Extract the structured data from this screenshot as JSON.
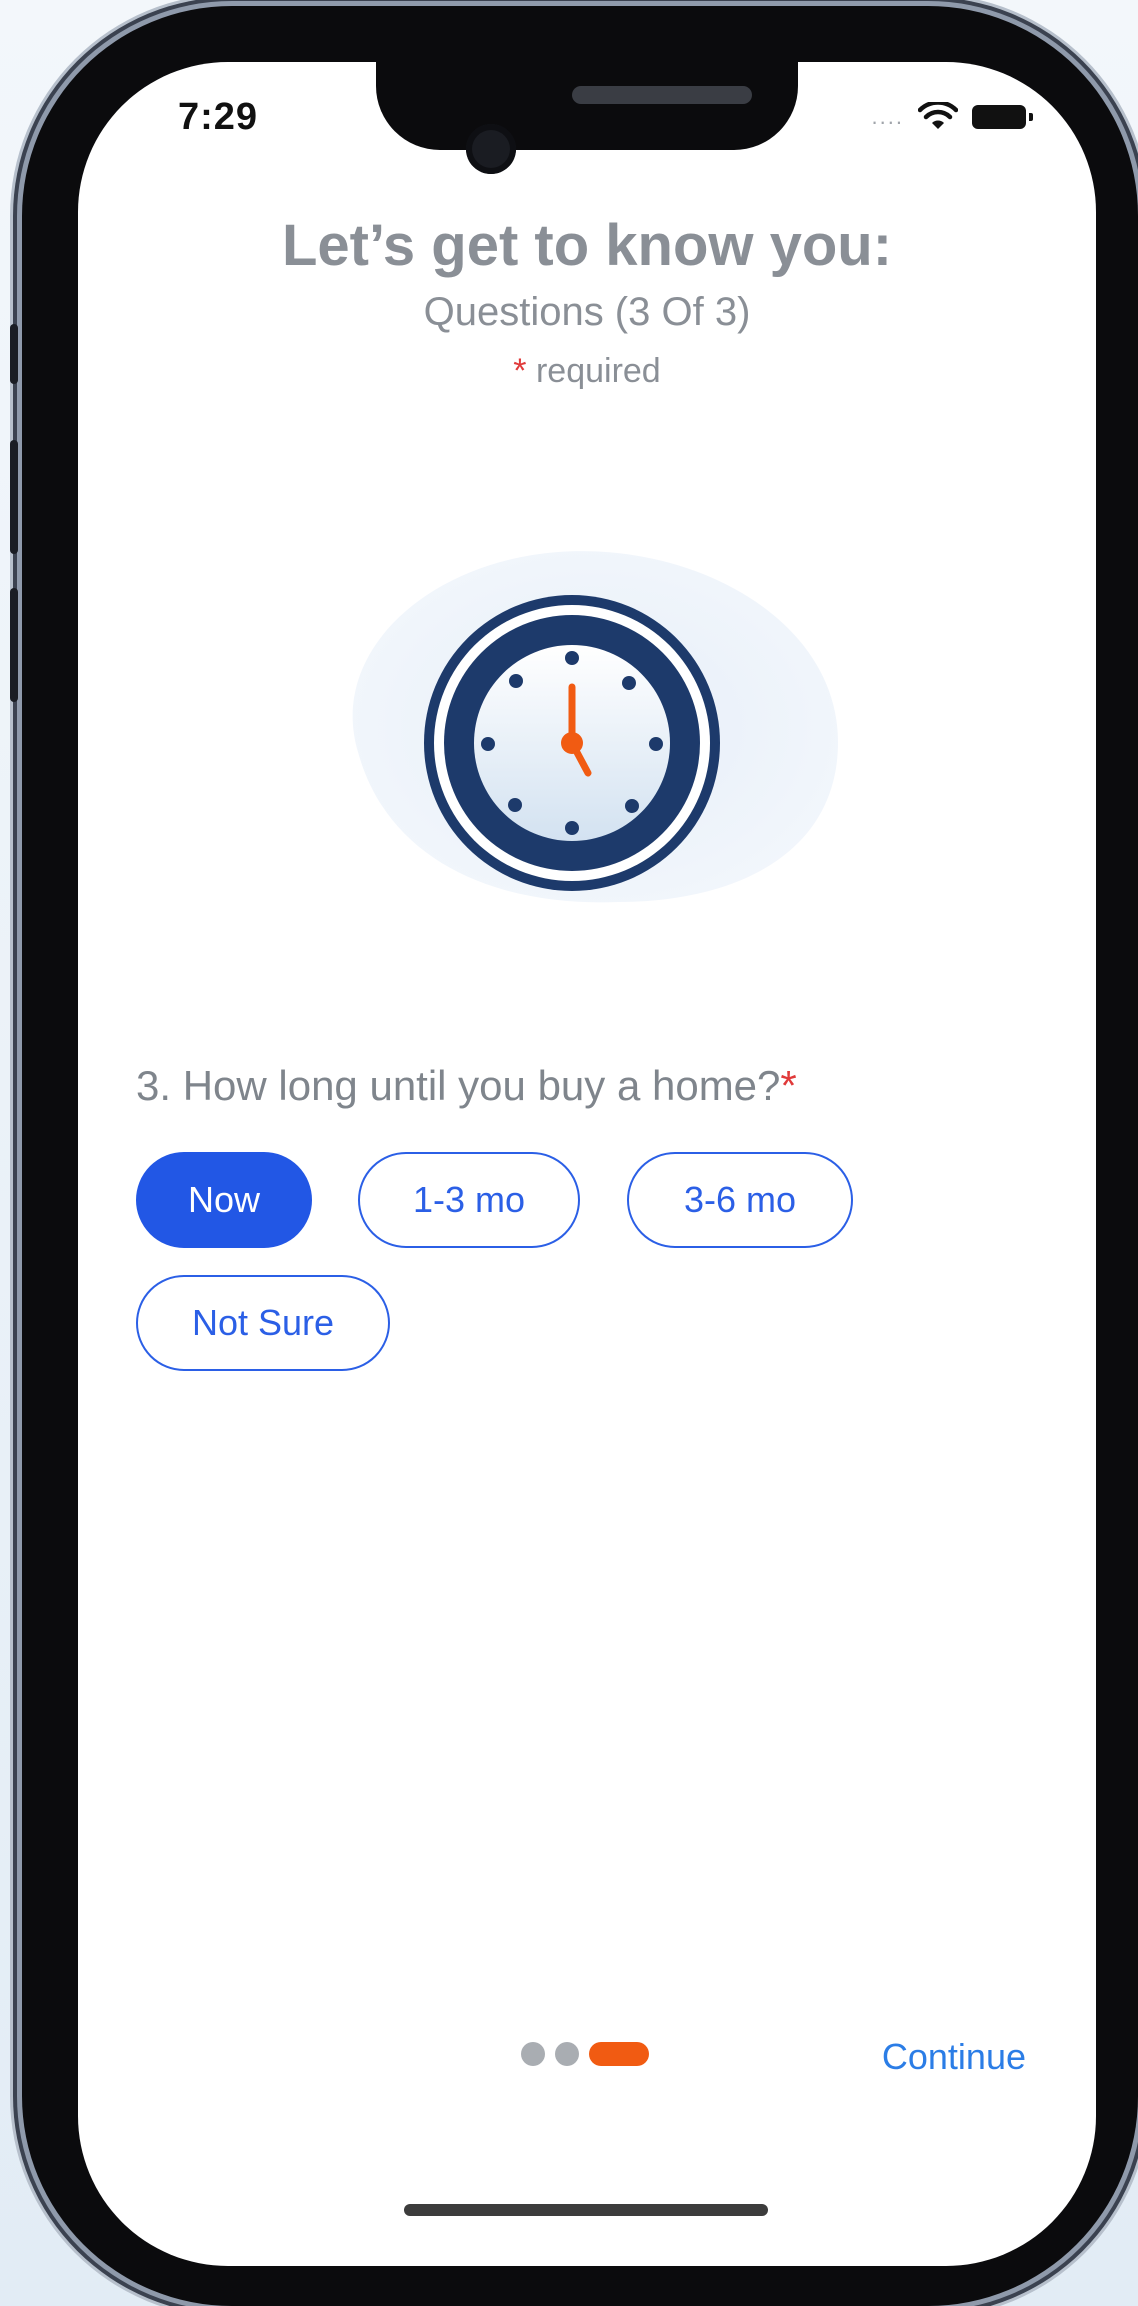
{
  "status_bar": {
    "time": "7:29",
    "signal": "....",
    "wifi_icon": "wifi-icon",
    "battery_icon": "battery-icon"
  },
  "header": {
    "title": "Let’s get to know you:",
    "subtitle": "Questions (3 Of 3)",
    "required_marker": "*",
    "required_text": "required"
  },
  "illustration": {
    "icon": "clock-icon",
    "accent_color": "#f15b12",
    "ring_color": "#1d3a6b"
  },
  "question": {
    "text": "3. How long until you buy a home?",
    "required_marker": "*"
  },
  "options": [
    {
      "label": "Now",
      "selected": true
    },
    {
      "label": "1-3 mo",
      "selected": false
    },
    {
      "label": "3-6 mo",
      "selected": false
    },
    {
      "label": "Not Sure",
      "selected": false
    }
  ],
  "pager": {
    "total": 3,
    "current": 3
  },
  "footer": {
    "continue_label": "Continue"
  },
  "colors": {
    "primary": "#2257e5",
    "accent": "#f15b12",
    "link": "#2b7de6",
    "required": "#e03a3a"
  }
}
